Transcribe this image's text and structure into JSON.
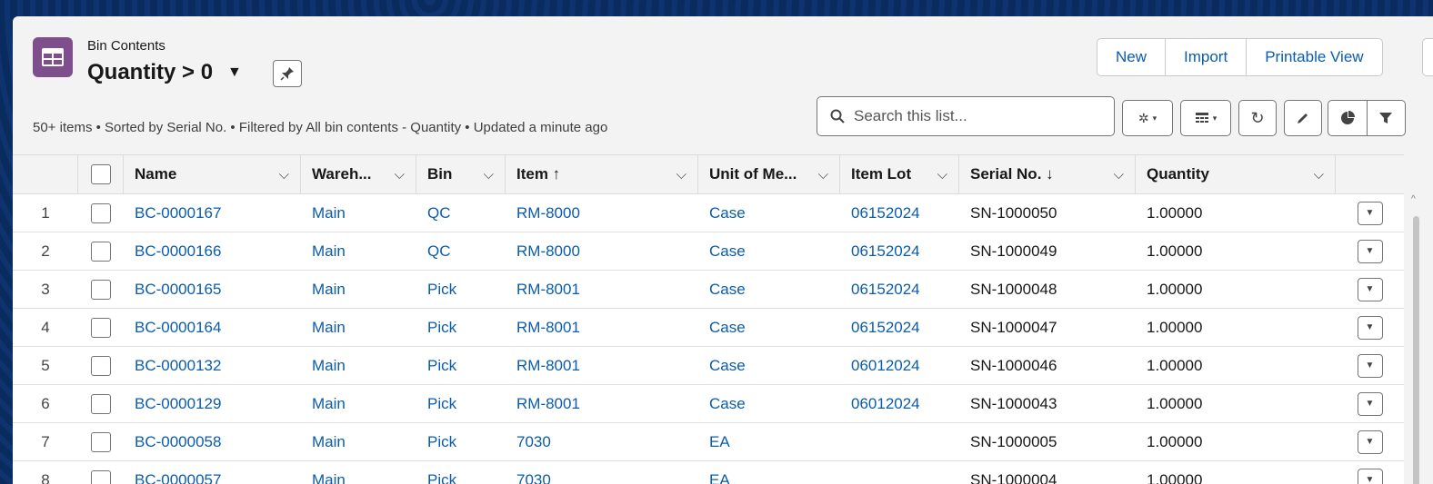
{
  "header": {
    "object_label": "Bin Contents",
    "list_view_name": "Quantity > 0",
    "meta": "50+ items • Sorted by Serial No. • Filtered by All bin contents - Quantity • Updated a minute ago",
    "buttons": {
      "new": "New",
      "import": "Import",
      "printable_view": "Printable View"
    },
    "search_placeholder": "Search this list..."
  },
  "columns": {
    "name": "Name",
    "warehouse": "Wareh...",
    "bin": "Bin",
    "item": "Item ↑",
    "unit": "Unit of Me...",
    "item_lot": "Item Lot",
    "serial": "Serial No. ↓",
    "quantity": "Quantity"
  },
  "rows": [
    {
      "num": "1",
      "name": "BC-0000167",
      "warehouse": "Main",
      "bin": "QC",
      "item": "RM-8000",
      "unit": "Case",
      "item_lot": "06152024",
      "serial": "SN-1000050",
      "quantity": "1.00000"
    },
    {
      "num": "2",
      "name": "BC-0000166",
      "warehouse": "Main",
      "bin": "QC",
      "item": "RM-8000",
      "unit": "Case",
      "item_lot": "06152024",
      "serial": "SN-1000049",
      "quantity": "1.00000"
    },
    {
      "num": "3",
      "name": "BC-0000165",
      "warehouse": "Main",
      "bin": "Pick",
      "item": "RM-8001",
      "unit": "Case",
      "item_lot": "06152024",
      "serial": "SN-1000048",
      "quantity": "1.00000"
    },
    {
      "num": "4",
      "name": "BC-0000164",
      "warehouse": "Main",
      "bin": "Pick",
      "item": "RM-8001",
      "unit": "Case",
      "item_lot": "06152024",
      "serial": "SN-1000047",
      "quantity": "1.00000"
    },
    {
      "num": "5",
      "name": "BC-0000132",
      "warehouse": "Main",
      "bin": "Pick",
      "item": "RM-8001",
      "unit": "Case",
      "item_lot": "06012024",
      "serial": "SN-1000046",
      "quantity": "1.00000"
    },
    {
      "num": "6",
      "name": "BC-0000129",
      "warehouse": "Main",
      "bin": "Pick",
      "item": "RM-8001",
      "unit": "Case",
      "item_lot": "06012024",
      "serial": "SN-1000043",
      "quantity": "1.00000"
    },
    {
      "num": "7",
      "name": "BC-0000058",
      "warehouse": "Main",
      "bin": "Pick",
      "item": "7030",
      "unit": "EA",
      "item_lot": "",
      "serial": "SN-1000005",
      "quantity": "1.00000"
    },
    {
      "num": "8",
      "name": "BC-0000057",
      "warehouse": "Main",
      "bin": "Pick",
      "item": "7030",
      "unit": "EA",
      "item_lot": "",
      "serial": "SN-1000004",
      "quantity": "1.00000"
    }
  ],
  "colors": {
    "link": "#0b5cab",
    "icon_bg": "#7f4e8c",
    "background": "#0b2a5a"
  },
  "icons": [
    "table-icon",
    "pin-icon",
    "search-icon",
    "gear-icon",
    "columns-icon",
    "refresh-icon",
    "edit-icon",
    "chart-icon",
    "filter-icon",
    "chevron-down-icon"
  ]
}
